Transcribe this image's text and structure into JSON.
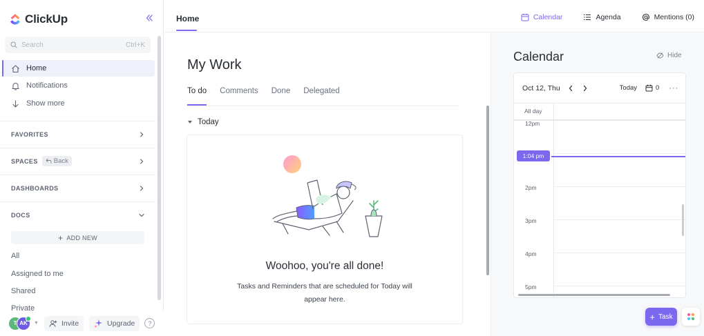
{
  "app": {
    "brand_name": "ClickUp"
  },
  "sidebar": {
    "search_placeholder": "Search",
    "search_shortcut": "Ctrl+K",
    "nav": [
      {
        "label": "Home"
      },
      {
        "label": "Notifications"
      },
      {
        "label": "Show more"
      }
    ],
    "sections": [
      {
        "title": "FAVORITES"
      },
      {
        "title": "SPACES",
        "chip": "Back"
      },
      {
        "title": "DASHBOARDS"
      },
      {
        "title": "DOCS"
      }
    ],
    "add_new_label": "ADD NEW",
    "docs_items": [
      {
        "label": "All"
      },
      {
        "label": "Assigned to me"
      },
      {
        "label": "Shared"
      },
      {
        "label": "Private"
      }
    ],
    "bottom": {
      "avatar_1": "T",
      "avatar_2": "AK",
      "invite_label": "Invite",
      "upgrade_label": "Upgrade",
      "help_label": "?"
    }
  },
  "topbar": {
    "tab_label": "Home",
    "actions": [
      {
        "label": "Calendar"
      },
      {
        "label": "Agenda"
      },
      {
        "label": "Mentions (0)"
      }
    ]
  },
  "main": {
    "title": "My Work",
    "tabs": [
      {
        "label": "To do"
      },
      {
        "label": "Comments"
      },
      {
        "label": "Done"
      },
      {
        "label": "Delegated"
      }
    ],
    "group_label": "Today",
    "empty_title": "Woohoo, you're all done!",
    "empty_desc": "Tasks and Reminders that are scheduled for Today will appear here."
  },
  "calendar": {
    "title": "Calendar",
    "hide_label": "Hide",
    "date_label": "Oct 12, Thu",
    "today_label": "Today",
    "count": "0",
    "more_label": "···",
    "all_day_label": "All day",
    "hours": [
      "12pm",
      "2pm",
      "3pm",
      "4pm",
      "5pm"
    ],
    "now_label": "1:04 pm"
  },
  "fab": {
    "task_label": "Task"
  },
  "colors": {
    "accent": "#7b68ee",
    "text": "#292d34"
  }
}
